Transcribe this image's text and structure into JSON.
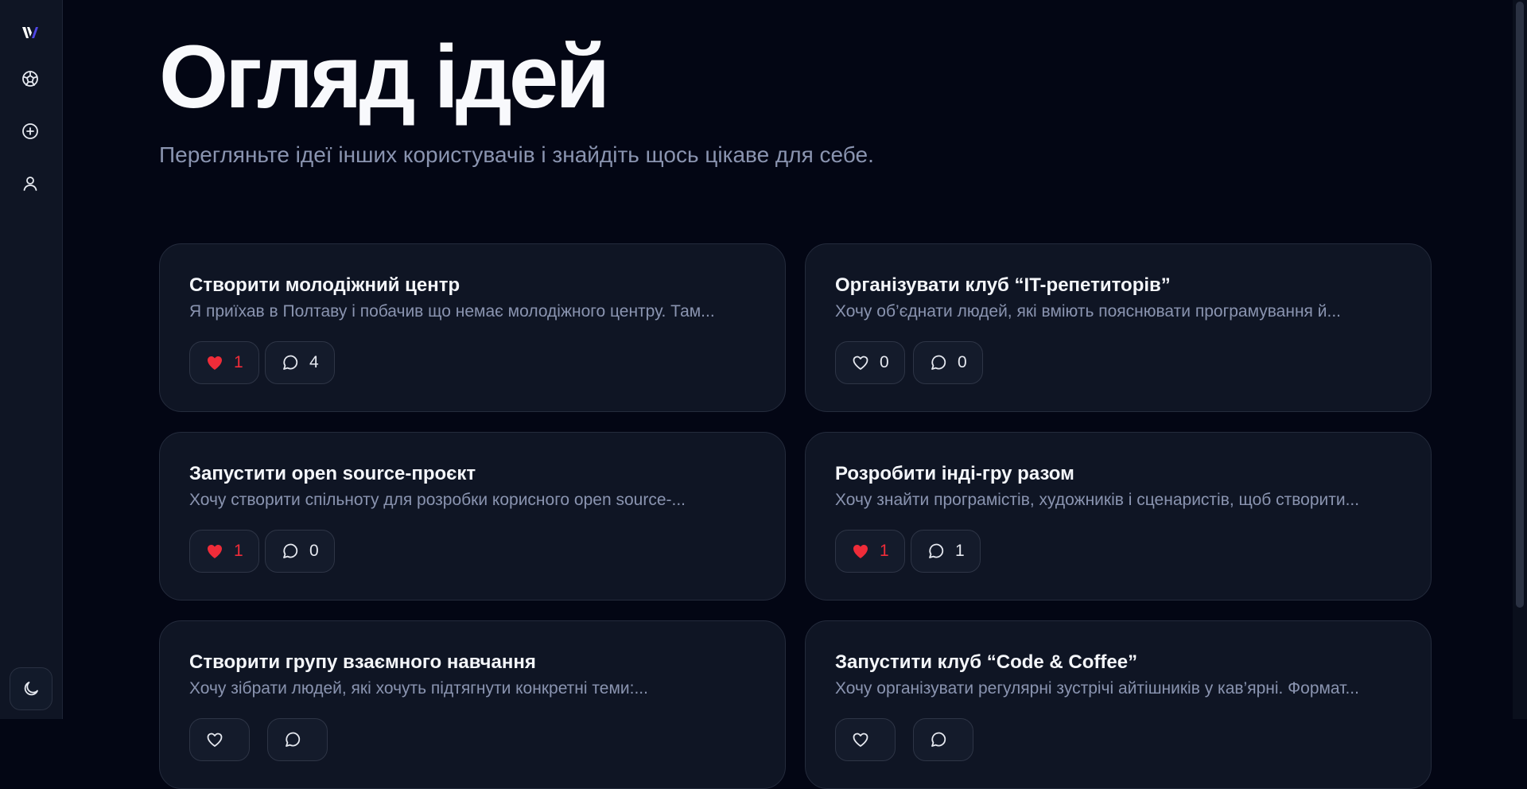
{
  "header": {
    "title": "Огляд ідей",
    "subtitle": "Перегляньте ідеї інших користувачів і знайдіть щось цікаве для себе."
  },
  "sidebar": {
    "items": [
      {
        "icon": "logo-icon"
      },
      {
        "icon": "explore-icon"
      },
      {
        "icon": "add-circle-icon"
      },
      {
        "icon": "user-icon"
      }
    ],
    "theme_toggle_icon": "moon-icon"
  },
  "colors": {
    "background": "#030614",
    "card": "#0f1524",
    "like_active": "#ef2c39",
    "logo_accent": "#4f46e5"
  },
  "ideas": [
    {
      "title": "Створити молодіжний центр",
      "description": "Я приїхав в Полтаву і побачив що немає молодіжного центру. Там...",
      "likes": "1",
      "comments": "4",
      "liked": true
    },
    {
      "title": "Організувати клуб “IT-репетиторів”",
      "description": "Хочу об’єднати людей, які вміють пояснювати програмування й...",
      "likes": "0",
      "comments": "0",
      "liked": false
    },
    {
      "title": "Запустити open source-проєкт",
      "description": "Хочу створити спільноту для розробки корисного open source-...",
      "likes": "1",
      "comments": "0",
      "liked": true
    },
    {
      "title": "Розробити інді-гру разом",
      "description": "Хочу знайти програмістів, художників і сценаристів, щоб створити...",
      "likes": "1",
      "comments": "1",
      "liked": true
    },
    {
      "title": "Створити групу взаємного навчання",
      "description": "Хочу зібрати людей, які хочуть підтягнути конкретні теми:...",
      "likes": "",
      "comments": "",
      "liked": false
    },
    {
      "title": "Запустити клуб “Code & Coffee”",
      "description": "Хочу організувати регулярні зустрічі айтішників у кав’ярні. Формат...",
      "likes": "",
      "comments": "",
      "liked": false
    }
  ]
}
